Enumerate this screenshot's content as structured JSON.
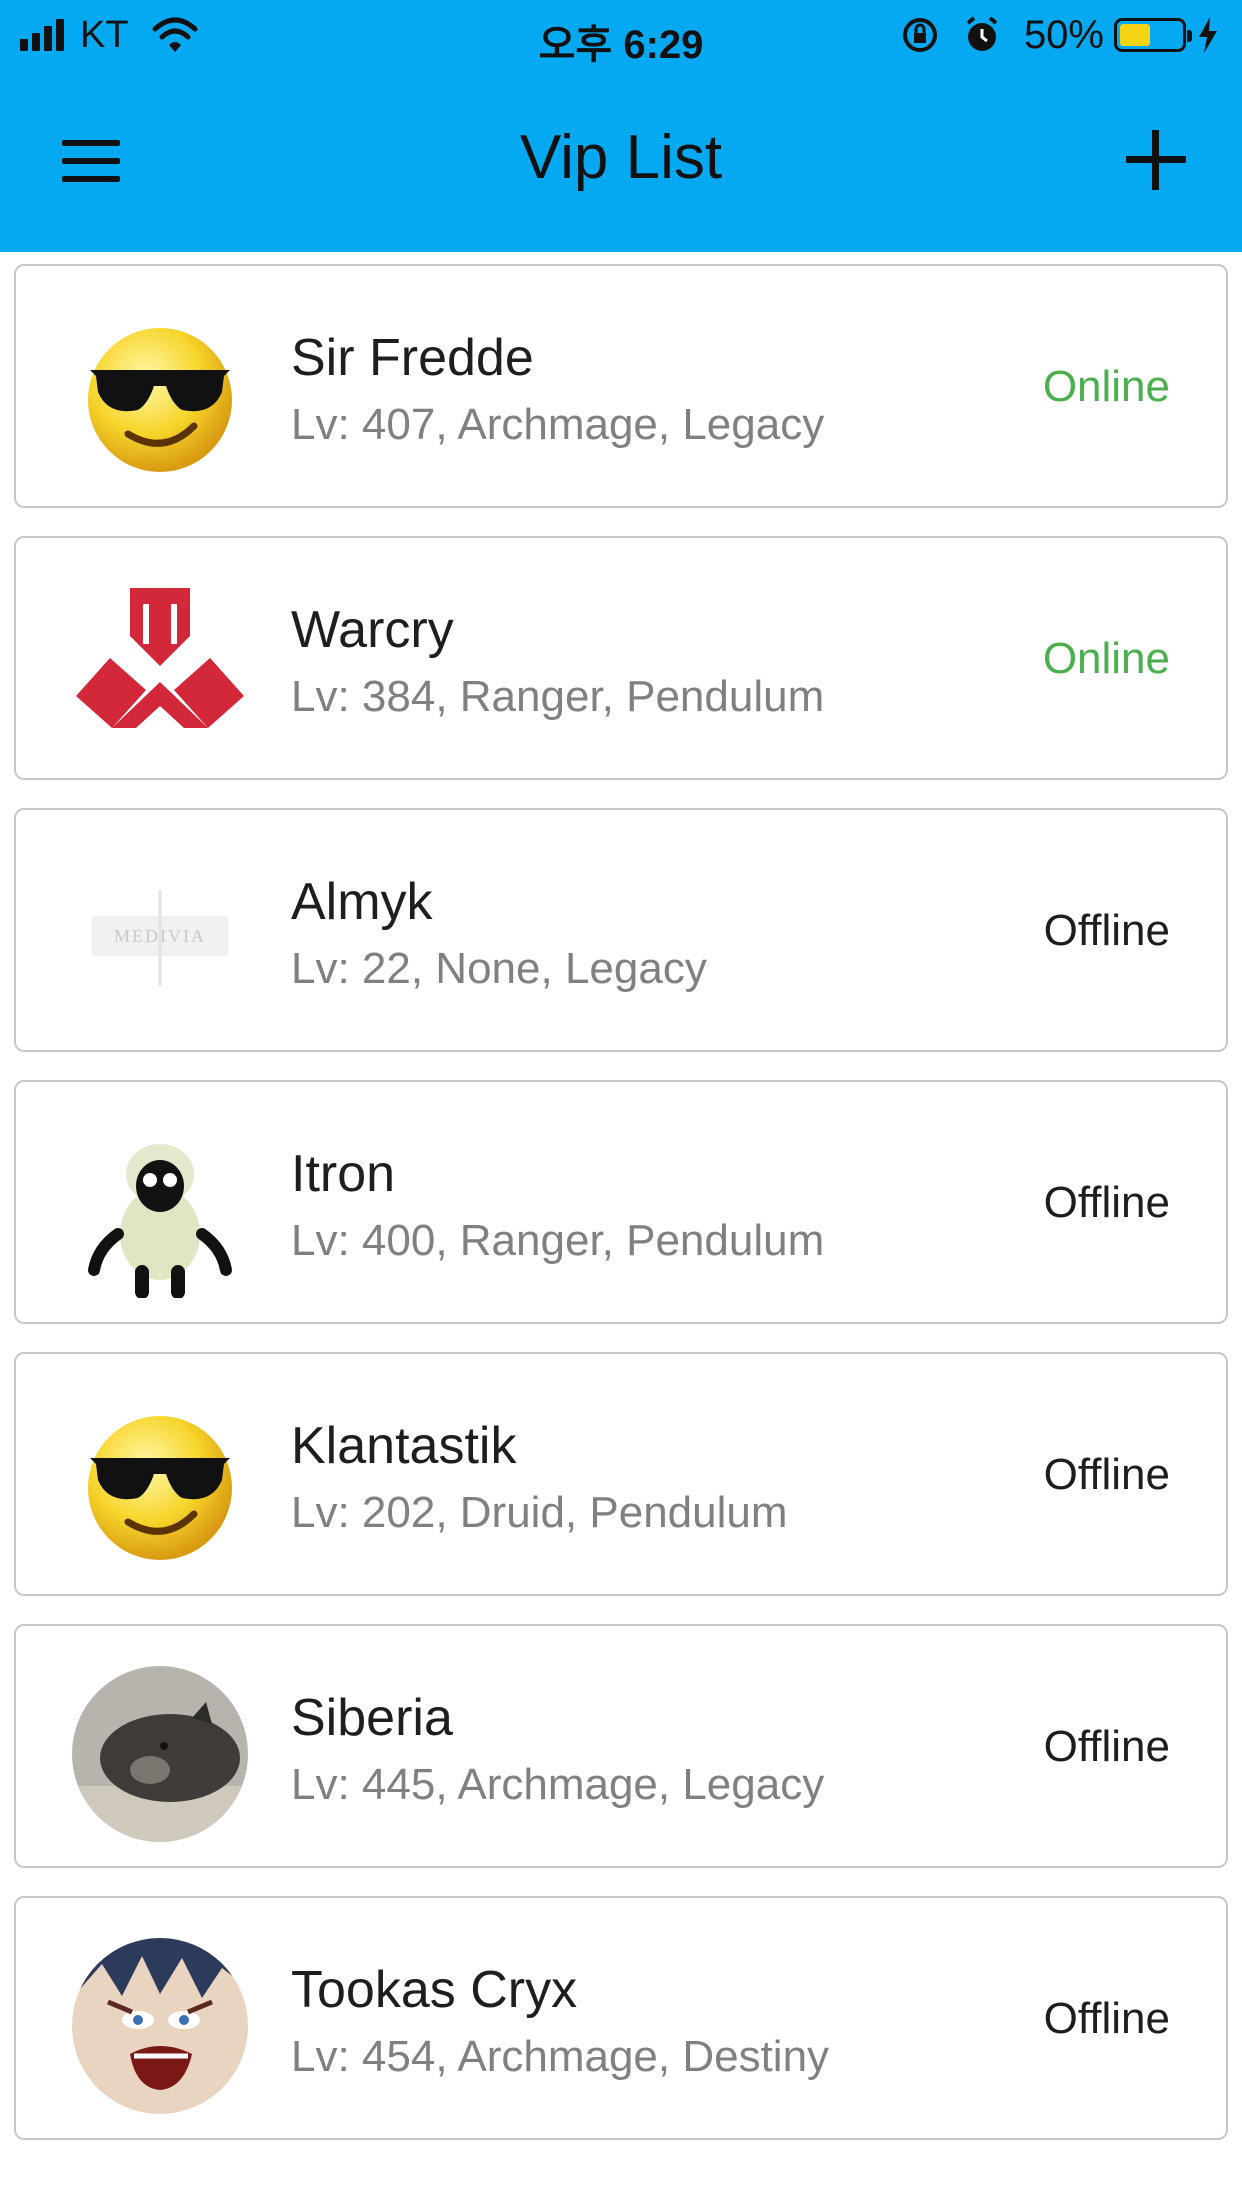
{
  "status_bar": {
    "carrier": "KT",
    "time": "오후 6:29",
    "battery_percent": "50%",
    "battery_level": 0.5,
    "battery_color": "#f5d315"
  },
  "app_bar": {
    "title": "Vip List",
    "menu_icon": "hamburger-menu-icon",
    "add_icon": "plus-icon",
    "background": "#04a9f2"
  },
  "vip_list": [
    {
      "name": "Sir Fredde",
      "details": "Lv: 407, Archmage, Legacy",
      "status": "Online",
      "online": true,
      "avatar": "sunglasses-smiley"
    },
    {
      "name": "Warcry",
      "details": "Lv: 384, Ranger, Pendulum",
      "status": "Online",
      "online": true,
      "avatar": "red-defqon-logo"
    },
    {
      "name": "Almyk",
      "details": "Lv: 22, None, Legacy",
      "status": "Offline",
      "online": false,
      "avatar": "medivia-logo"
    },
    {
      "name": "Itron",
      "details": "Lv: 400, Ranger, Pendulum",
      "status": "Offline",
      "online": false,
      "avatar": "sheep-plush"
    },
    {
      "name": "Klantastik",
      "details": "Lv: 202, Druid, Pendulum",
      "status": "Offline",
      "online": false,
      "avatar": "sunglasses-smiley"
    },
    {
      "name": "Siberia",
      "details": "Lv: 445, Archmage, Legacy",
      "status": "Offline",
      "online": false,
      "avatar": "boar-photo"
    },
    {
      "name": "Tookas Cryx",
      "details": "Lv: 454, Archmage, Destiny",
      "status": "Offline",
      "online": false,
      "avatar": "anime-face"
    }
  ],
  "colors": {
    "online": "#4aaf4c",
    "offline": "#1e1e1e",
    "details": "#808080"
  }
}
